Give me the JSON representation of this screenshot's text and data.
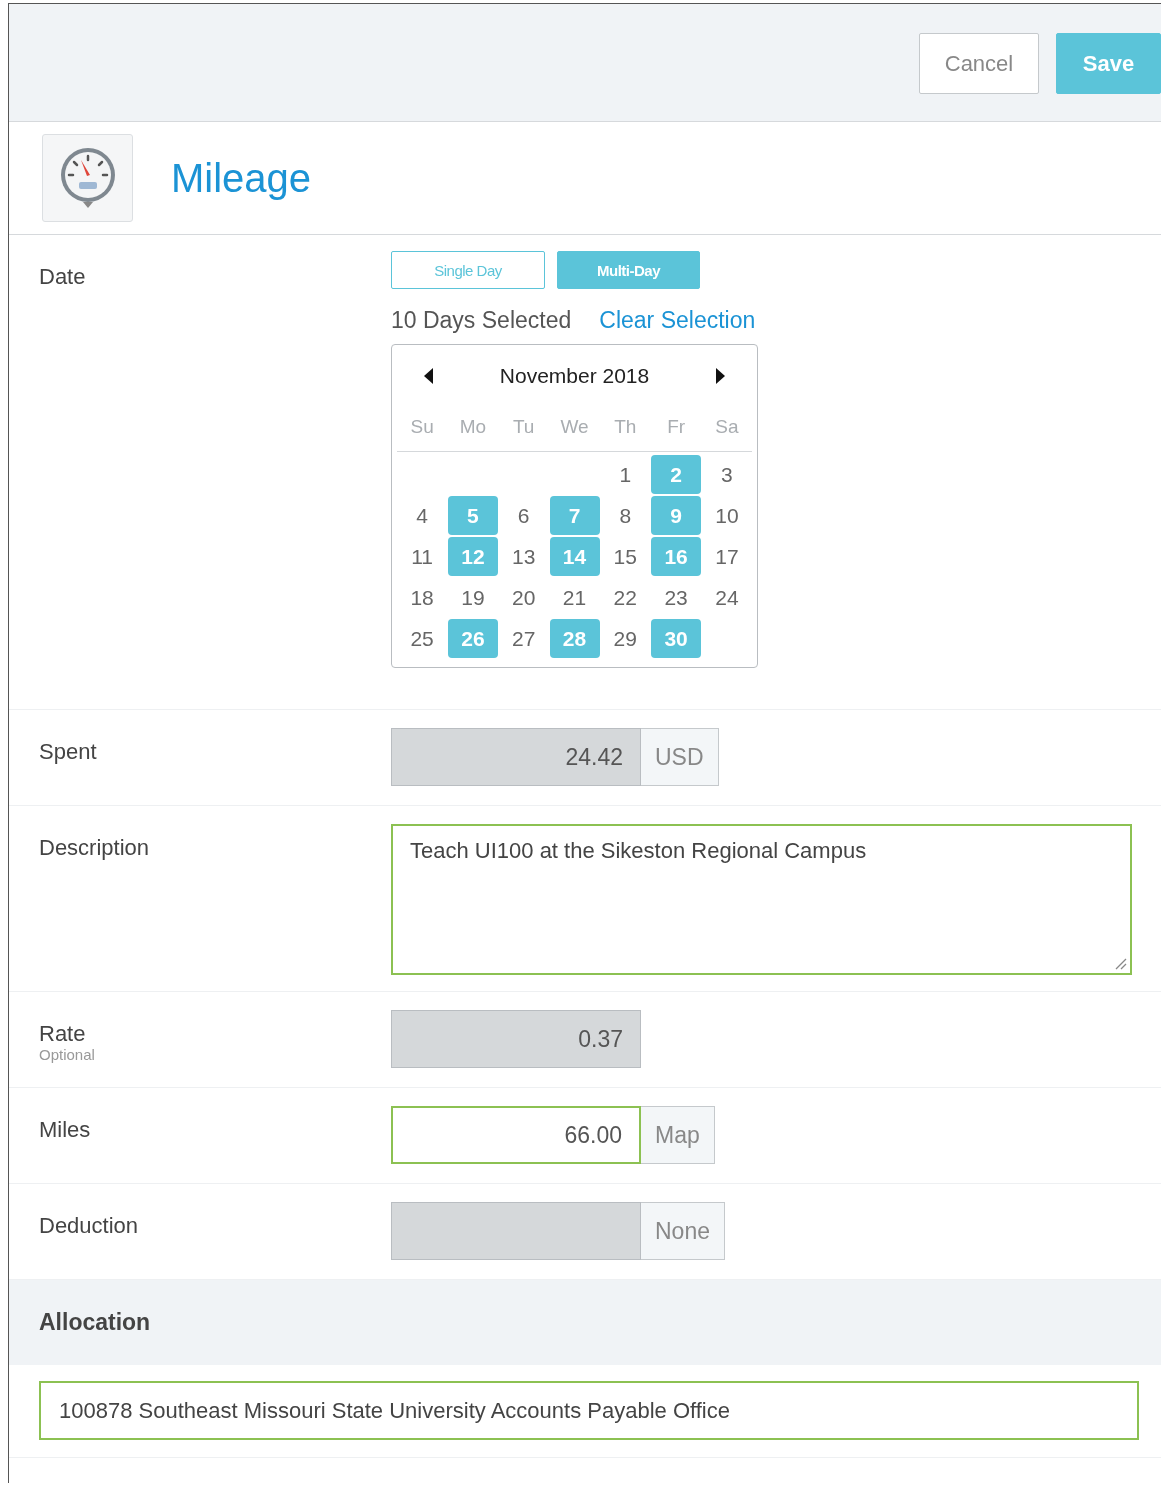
{
  "header": {
    "buttons": [
      {
        "label": "Cancel",
        "kind": "secondary"
      },
      {
        "label": "Save",
        "kind": "primary"
      }
    ]
  },
  "title": "Mileage",
  "date": {
    "label": "Date",
    "modes": [
      {
        "label": "Single Day",
        "selected": false
      },
      {
        "label": "Multi-Day",
        "selected": true
      }
    ],
    "summary": "10 Days Selected",
    "clear_link": "Clear Selection",
    "calendar": {
      "month": "November 2018",
      "weekdays": [
        "Su",
        "Mo",
        "Tu",
        "We",
        "Th",
        "Fr",
        "Sa"
      ],
      "weeks": [
        [
          {
            "kind": "blank"
          },
          {
            "kind": "blank"
          },
          {
            "kind": "blank"
          },
          {
            "kind": "blank"
          },
          {
            "day": "1",
            "selected": false
          },
          {
            "day": "2",
            "selected": true
          },
          {
            "day": "3",
            "selected": false
          }
        ],
        [
          {
            "day": "4",
            "selected": false
          },
          {
            "day": "5",
            "selected": true
          },
          {
            "day": "6",
            "selected": false
          },
          {
            "day": "7",
            "selected": true
          },
          {
            "day": "8",
            "selected": false
          },
          {
            "day": "9",
            "selected": true
          },
          {
            "day": "10",
            "selected": false
          }
        ],
        [
          {
            "day": "11",
            "selected": false
          },
          {
            "day": "12",
            "selected": true
          },
          {
            "day": "13",
            "selected": false
          },
          {
            "day": "14",
            "selected": true
          },
          {
            "day": "15",
            "selected": false
          },
          {
            "day": "16",
            "selected": true
          },
          {
            "day": "17",
            "selected": false
          }
        ],
        [
          {
            "day": "18",
            "selected": false
          },
          {
            "day": "19",
            "selected": false
          },
          {
            "day": "20",
            "selected": false
          },
          {
            "day": "21",
            "selected": false
          },
          {
            "day": "22",
            "selected": false
          },
          {
            "day": "23",
            "selected": false
          },
          {
            "day": "24",
            "selected": false
          }
        ],
        [
          {
            "day": "25",
            "selected": false
          },
          {
            "day": "26",
            "selected": true
          },
          {
            "day": "27",
            "selected": false
          },
          {
            "day": "28",
            "selected": true
          },
          {
            "day": "29",
            "selected": false
          },
          {
            "day": "30",
            "selected": true
          },
          {
            "kind": "blank"
          }
        ]
      ]
    }
  },
  "fields": [
    {
      "label": "Spent",
      "kind": "input",
      "value": "24.42",
      "addon": "USD",
      "disabled": true
    },
    {
      "label": "Description",
      "kind": "textarea",
      "value": "Teach UI100 at the Sikeston Regional Campus",
      "disabled": false
    },
    {
      "label": "Rate",
      "hint": "Optional",
      "kind": "input",
      "value": "0.37",
      "disabled": true
    },
    {
      "label": "Miles",
      "kind": "input",
      "value": "66.00",
      "addon": "Map",
      "disabled": false
    },
    {
      "label": "Deduction",
      "kind": "input",
      "addon": "None",
      "disabled": true
    }
  ],
  "allocation": {
    "heading": "Allocation",
    "value": "100878 Southeast Missouri State University Accounts Payable Office"
  }
}
